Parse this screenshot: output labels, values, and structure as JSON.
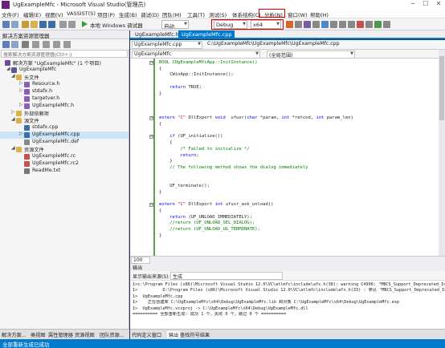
{
  "window": {
    "title": "UgExampleMfc - Microsoft Visual Studio(管理员)",
    "minimize": "─",
    "maximize": "☐",
    "close": "✕"
  },
  "menu": [
    "文件(F)",
    "编辑(E)",
    "视图(V)",
    "VASSIST(S)",
    "项目(P)",
    "生成(B)",
    "调试(D)",
    "团队(M)",
    "工具(T)",
    "测试(S)",
    "体系结构(C)",
    "分析(N)",
    "窗口(W)",
    "帮助(H)"
  ],
  "toolbar": {
    "debugger": "本地 Windows 调试器",
    "auto": "自动",
    "config": "Debug",
    "platform": "x64"
  },
  "solution_explorer": {
    "header": "解决方案资源管理器",
    "search_placeholder": "搜索解决方案资源管理器(Ctrl+;)",
    "tree": [
      {
        "label": "解决方案 \"UgExampleMfc\" (1 个项目)",
        "icon": "solution-icon",
        "expander": ""
      },
      {
        "label": "UgExampleMfc",
        "icon": "project-icon",
        "expander": "◢"
      },
      {
        "label": "头文件",
        "icon": "folder-icon",
        "expander": "◢"
      },
      {
        "label": "Resource.h",
        "icon": "header-file-icon",
        "expander": "▷"
      },
      {
        "label": "stdafx.h",
        "icon": "header-file-icon",
        "expander": "▷"
      },
      {
        "label": "targetver.h",
        "icon": "header-file-icon",
        "expander": ""
      },
      {
        "label": "UgExampleMfc.h",
        "icon": "header-file-icon",
        "expander": "▷"
      },
      {
        "label": "外部依赖项",
        "icon": "folder-icon",
        "expander": "▷"
      },
      {
        "label": "源文件",
        "icon": "folder-icon",
        "expander": "◢"
      },
      {
        "label": "stdafx.cpp",
        "icon": "cpp-file-icon",
        "expander": ""
      },
      {
        "label": "UgExampleMfc.cpp",
        "icon": "cpp-file-icon",
        "expander": "▷"
      },
      {
        "label": "UgExampleMfc.def",
        "icon": "def-file-icon",
        "expander": ""
      },
      {
        "label": "资源文件",
        "icon": "folder-icon",
        "expander": "◢"
      },
      {
        "label": "UgExampleMfc.rc",
        "icon": "rc-file-icon",
        "expander": ""
      },
      {
        "label": "UgExampleMfc.rc2",
        "icon": "rc-file-icon",
        "expander": ""
      },
      {
        "label": "ReadMe.txt",
        "icon": "text-file-icon",
        "expander": ""
      }
    ],
    "tabs": [
      "解决方案...",
      "类视图",
      "属性管理器",
      "资源视图",
      "团队资源..."
    ]
  },
  "editor": {
    "tabs": [
      "UgExampleMfc.h",
      "UgExampleMfc.cpp"
    ],
    "nav_left": "UgExampleMfc.cpp",
    "nav_path": "C:\\UgExampleMfc\\UgExampleMfc\\UgExampleMfc.cpp",
    "nav_mid": "UgExampleMfc",
    "nav_right": "(全局范围)",
    "zoom": "100 %",
    "code": [
      {
        "outline": "⊟",
        "segments": [
          {
            "t": "BOOL CUgExampleMfcApp::InitInstance()",
            "c": "cm"
          }
        ]
      },
      {
        "outline": "",
        "segments": [
          {
            "t": "{",
            "c": ""
          }
        ]
      },
      {
        "outline": "",
        "segments": [
          {
            "t": "    CWinApp::InitInstance();",
            "c": ""
          }
        ]
      },
      {
        "outline": "",
        "segments": [
          {
            "t": "",
            "c": ""
          }
        ]
      },
      {
        "outline": "",
        "segments": [
          {
            "t": "    return ",
            "c": "kw"
          },
          {
            "t": "TRUE;",
            "c": ""
          }
        ]
      },
      {
        "outline": "",
        "segments": [
          {
            "t": "}",
            "c": ""
          }
        ]
      },
      {
        "outline": "",
        "segments": [
          {
            "t": "",
            "c": ""
          }
        ]
      },
      {
        "outline": "",
        "segments": [
          {
            "t": "",
            "c": ""
          }
        ]
      },
      {
        "outline": "",
        "segments": [
          {
            "t": "",
            "c": ""
          }
        ]
      },
      {
        "outline": "⊟",
        "segments": [
          {
            "t": "extern ",
            "c": "kw"
          },
          {
            "t": "\"C\" ",
            "c": "str"
          },
          {
            "t": "DllExport ",
            "c": ""
          },
          {
            "t": "void ",
            "c": "kw"
          },
          {
            "t": " ufusr(",
            "c": ""
          },
          {
            "t": "char ",
            "c": "kw"
          },
          {
            "t": "*param, ",
            "c": ""
          },
          {
            "t": "int ",
            "c": "kw"
          },
          {
            "t": "*retcod, ",
            "c": ""
          },
          {
            "t": "int ",
            "c": "kw"
          },
          {
            "t": "param_len)",
            "c": ""
          }
        ]
      },
      {
        "outline": "",
        "segments": [
          {
            "t": "{",
            "c": ""
          }
        ]
      },
      {
        "outline": "",
        "segments": [
          {
            "t": "",
            "c": ""
          }
        ]
      },
      {
        "outline": "⊟",
        "segments": [
          {
            "t": "    if ",
            "c": "kw"
          },
          {
            "t": "(UF_initialize())",
            "c": ""
          }
        ]
      },
      {
        "outline": "",
        "segments": [
          {
            "t": "    {",
            "c": ""
          }
        ]
      },
      {
        "outline": "",
        "segments": [
          {
            "t": "        /* Failed to initialize */",
            "c": "cm"
          }
        ]
      },
      {
        "outline": "",
        "segments": [
          {
            "t": "        return",
            "c": "kw"
          },
          {
            "t": ";",
            "c": ""
          }
        ]
      },
      {
        "outline": "",
        "segments": [
          {
            "t": "    }",
            "c": ""
          }
        ]
      },
      {
        "outline": "",
        "segments": [
          {
            "t": "    // The following method shows the dialog immediately",
            "c": "cm"
          }
        ]
      },
      {
        "outline": "",
        "segments": [
          {
            "t": "",
            "c": ""
          }
        ]
      },
      {
        "outline": "",
        "segments": [
          {
            "t": "",
            "c": ""
          }
        ]
      },
      {
        "outline": "",
        "segments": [
          {
            "t": "    UF_terminate();",
            "c": ""
          }
        ]
      },
      {
        "outline": "",
        "segments": [
          {
            "t": "}",
            "c": ""
          }
        ]
      },
      {
        "outline": "",
        "segments": [
          {
            "t": "",
            "c": ""
          }
        ]
      },
      {
        "outline": "⊟",
        "segments": [
          {
            "t": "extern ",
            "c": "kw"
          },
          {
            "t": "\"C\" ",
            "c": "str"
          },
          {
            "t": "DllExport ",
            "c": ""
          },
          {
            "t": "int ",
            "c": "kw"
          },
          {
            "t": "ufusr_ask_unload()",
            "c": ""
          }
        ]
      },
      {
        "outline": "",
        "segments": [
          {
            "t": "{",
            "c": ""
          }
        ]
      },
      {
        "outline": "",
        "segments": [
          {
            "t": "    return ",
            "c": "kw"
          },
          {
            "t": "(UF_UNLOAD_IMMEDIATELY);",
            "c": ""
          }
        ]
      },
      {
        "outline": "",
        "segments": [
          {
            "t": "    //return (UF_UNLOAD_SEL_DIALOG);",
            "c": "cm"
          }
        ]
      },
      {
        "outline": "",
        "segments": [
          {
            "t": "    //return (UF_UNLOAD_UG_TERMINATE);",
            "c": "cm"
          }
        ]
      },
      {
        "outline": "",
        "segments": [
          {
            "t": "}",
            "c": ""
          }
        ]
      }
    ]
  },
  "output": {
    "header": "输出",
    "show_from_label": "显示输出来源(S):",
    "source": "生成",
    "lines": [
      "1>c:\\Program Files (x86)\\Microsoft Visual Studio 12.0\\VC\\atlmfc\\include\\afx.h(38): warning C4996: \"MBCS_Support_Deprecated_In_MFC\": MBCS",
      "1>          D:\\Program Files (x86)\\Microsoft Visual Studio 12.0\\VC\\atlmfc\\include\\afx.h(33) : 参见 \"MBCS_Support_Deprecated_In_MFC\" 的声明",
      "1>  UgExampleMfc.cpp",
      "1>    正在创建库 C:\\UgExampleMfc\\x64\\Debug\\UgExampleMfc.lib 和对象 C:\\UgExampleMfc\\x64\\Debug\\UgExampleMfc.exp",
      "1>  UgExampleMfc.vcxproj -> C:\\UgExampleMfc\\x64\\Debug\\UgExampleMfc.dll",
      "========== 全部重新生成: 成功 1 个，失败 0 个，跳过 0 个 =========="
    ],
    "tabs": [
      "代码定义窗口",
      "输出",
      "查找符号结果"
    ]
  },
  "status": "全部重新生成已成功"
}
